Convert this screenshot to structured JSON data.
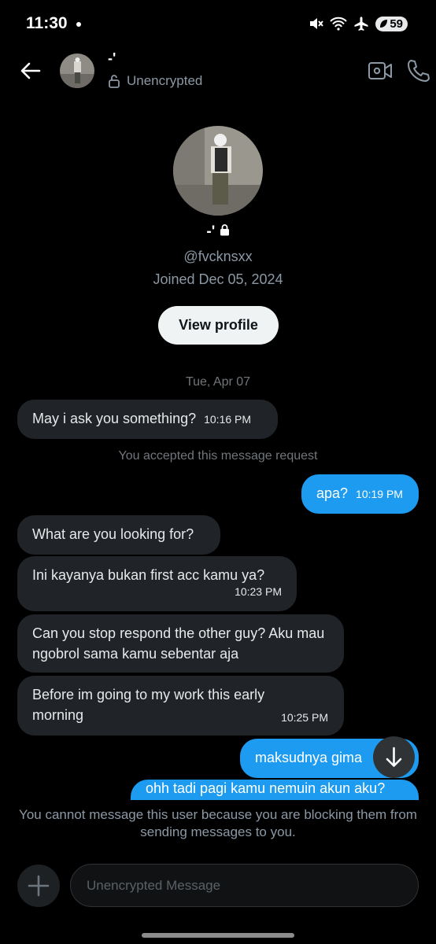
{
  "status_bar": {
    "time": "11:30",
    "battery": "59"
  },
  "header": {
    "name": "-'",
    "subtitle": "Unencrypted"
  },
  "profile": {
    "name": "-'",
    "handle": "@fvcknsxx",
    "joined": "Joined Dec 05, 2024",
    "view_profile_label": "View profile"
  },
  "conversation": {
    "date_separator": "Tue, Apr 07",
    "system_note": "You accepted this message request",
    "messages": [
      {
        "side": "in",
        "text": "May i ask you something?",
        "time": "10:16 PM"
      },
      {
        "side": "out",
        "text": "apa?",
        "time": "10:19 PM"
      },
      {
        "side": "in",
        "text": "What are you looking for?",
        "time": ""
      },
      {
        "side": "in",
        "text": "Ini kayanya bukan first acc kamu ya?",
        "time": "10:23 PM"
      },
      {
        "side": "in",
        "text": "Can you stop respond the other guy? Aku mau ngobrol sama kamu sebentar aja",
        "time": ""
      },
      {
        "side": "in",
        "text": "Before im going to my work this early morning",
        "time": "10:25 PM"
      },
      {
        "side": "out",
        "text": "maksudnya gima",
        "time": ""
      },
      {
        "side": "out",
        "text": "ohh tadi pagi kamu nemuin akun aku?",
        "time": ""
      }
    ]
  },
  "footer": {
    "blocked_notice": "You cannot message this user because you are blocking them from sending messages to you.",
    "input_placeholder": "Unencrypted Message"
  },
  "colors": {
    "accent": "#1d9bf0",
    "incoming_bubble": "#202327",
    "background": "#000000"
  },
  "icons": [
    "back-arrow-icon",
    "lock-icon",
    "video-call-icon",
    "phone-icon",
    "plus-icon",
    "arrow-down-icon"
  ]
}
